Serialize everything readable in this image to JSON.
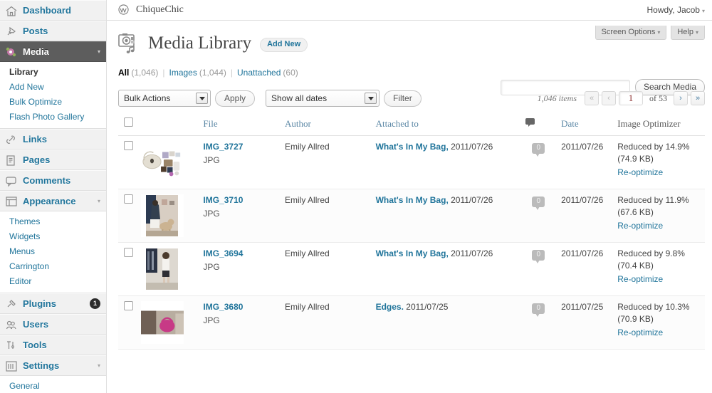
{
  "sidebar": {
    "items": [
      {
        "label": "Dashboard",
        "icon": "dashboard-icon",
        "current": false,
        "arrow": false,
        "badge": null
      },
      {
        "label": "Posts",
        "icon": "pin-icon",
        "current": false,
        "arrow": false,
        "badge": null
      },
      {
        "label": "Media",
        "icon": "media-icon",
        "current": true,
        "arrow": true,
        "badge": null
      },
      {
        "label": "Links",
        "icon": "link-icon",
        "current": false,
        "arrow": false,
        "badge": null
      },
      {
        "label": "Pages",
        "icon": "page-icon",
        "current": false,
        "arrow": false,
        "badge": null
      },
      {
        "label": "Comments",
        "icon": "comment-icon",
        "current": false,
        "arrow": false,
        "badge": null
      },
      {
        "label": "Appearance",
        "icon": "appearance-icon",
        "current": false,
        "arrow": true,
        "badge": null
      },
      {
        "label": "Plugins",
        "icon": "plugin-icon",
        "current": false,
        "arrow": false,
        "badge": "1"
      },
      {
        "label": "Users",
        "icon": "users-icon",
        "current": false,
        "arrow": false,
        "badge": null
      },
      {
        "label": "Tools",
        "icon": "tools-icon",
        "current": false,
        "arrow": false,
        "badge": null
      },
      {
        "label": "Settings",
        "icon": "settings-icon",
        "current": false,
        "arrow": true,
        "badge": null
      }
    ],
    "media_submenu": [
      {
        "label": "Library",
        "current": true
      },
      {
        "label": "Add New",
        "current": false
      },
      {
        "label": "Bulk Optimize",
        "current": false
      },
      {
        "label": "Flash Photo Gallery",
        "current": false
      }
    ],
    "appearance_submenu": [
      {
        "label": "Themes",
        "current": false
      },
      {
        "label": "Widgets",
        "current": false
      },
      {
        "label": "Menus",
        "current": false
      },
      {
        "label": "Carrington",
        "current": false
      },
      {
        "label": "Editor",
        "current": false
      }
    ],
    "settings_submenu": [
      {
        "label": "General",
        "current": false
      }
    ]
  },
  "adminbar": {
    "site_name": "ChiqueChic",
    "site_icon": "wordpress-logo-icon",
    "howdy": "Howdy, Jacob",
    "howdy_arrow": "▾"
  },
  "screen_meta": {
    "screen_options": "Screen Options",
    "help": "Help",
    "arrow": "▾"
  },
  "header": {
    "title": "Media Library",
    "title_icon": "media-library-icon",
    "add_new": "Add New"
  },
  "filters": {
    "items": [
      {
        "label": "All",
        "count": "(1,046)",
        "current": true
      },
      {
        "label": "Images",
        "count": "(1,044)",
        "current": false
      },
      {
        "label": "Unattached",
        "count": "(60)",
        "current": false
      }
    ],
    "separator": "|"
  },
  "search": {
    "value": "",
    "placeholder": "",
    "button": "Search Media"
  },
  "tablenav": {
    "bulk_actions": "Bulk Actions",
    "apply": "Apply",
    "show_dates": "Show all dates",
    "filter": "Filter",
    "displaying_num": "1,046 items",
    "first_page": "«",
    "prev_page": "‹",
    "current_page": "1",
    "of_total": "of 53",
    "next_page": "›",
    "last_page": "»"
  },
  "table": {
    "columns": {
      "file": "File",
      "author": "Author",
      "attached_to": "Attached to",
      "comments_icon": "comment-icon",
      "date": "Date",
      "optimizer": "Image Optimizer"
    },
    "rows": [
      {
        "filename": "IMG_3727",
        "filetype": "JPG",
        "author": "Emily Allred",
        "attached_post": "What's In My Bag,",
        "attached_date": "2011/07/26",
        "comments": "0",
        "date": "2011/07/26",
        "optimizer_text": "Reduced by 14.9% (74.9 KB)",
        "reoptimize": "Re-optimize",
        "thumb": "handbag-contents-photo"
      },
      {
        "filename": "IMG_3710",
        "filetype": "JPG",
        "author": "Emily Allred",
        "attached_post": "What's In My Bag,",
        "attached_date": "2011/07/26",
        "comments": "0",
        "date": "2011/07/26",
        "optimizer_text": "Reduced by 11.9% (67.6 KB)",
        "reoptimize": "Re-optimize",
        "thumb": "person-with-dog-photo"
      },
      {
        "filename": "IMG_3694",
        "filetype": "JPG",
        "author": "Emily Allred",
        "attached_post": "What's In My Bag,",
        "attached_date": "2011/07/26",
        "comments": "0",
        "date": "2011/07/26",
        "optimizer_text": "Reduced by 9.8% (70.4 KB)",
        "reoptimize": "Re-optimize",
        "thumb": "woman-shopping-photo"
      },
      {
        "filename": "IMG_3680",
        "filetype": "JPG",
        "author": "Emily Allred",
        "attached_post": "Edges.",
        "attached_date": "2011/07/25",
        "comments": "0",
        "date": "2011/07/25",
        "optimizer_text": "Reduced by 10.3% (70.9 KB)",
        "reoptimize": "Re-optimize",
        "thumb": "pink-handbag-photo"
      }
    ]
  },
  "colors": {
    "link": "#21759b",
    "sidebar_bg": "#f1f1f1",
    "current_menu_bg": "#5d5d5d",
    "heading": "#464646"
  }
}
